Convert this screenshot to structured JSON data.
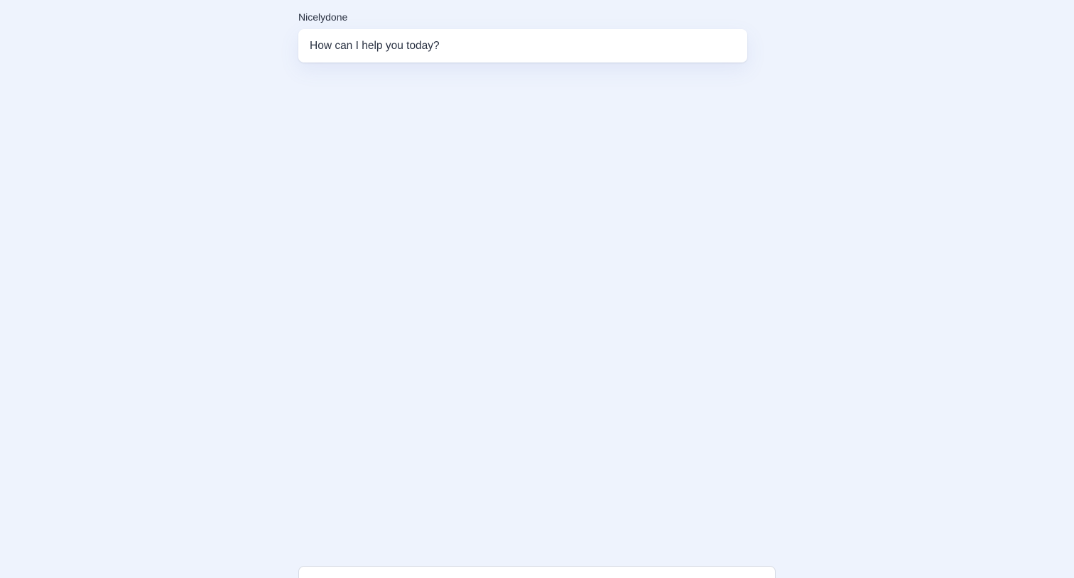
{
  "conversation": {
    "messages": [
      {
        "sender": "Nicelydone",
        "text": "How can I help you today?"
      }
    ]
  },
  "composer": {
    "value": "",
    "placeholder": ""
  },
  "colors": {
    "background": "#eef3fd",
    "bubble": "#ffffff",
    "text": "#283041",
    "border": "#d6dae3"
  }
}
